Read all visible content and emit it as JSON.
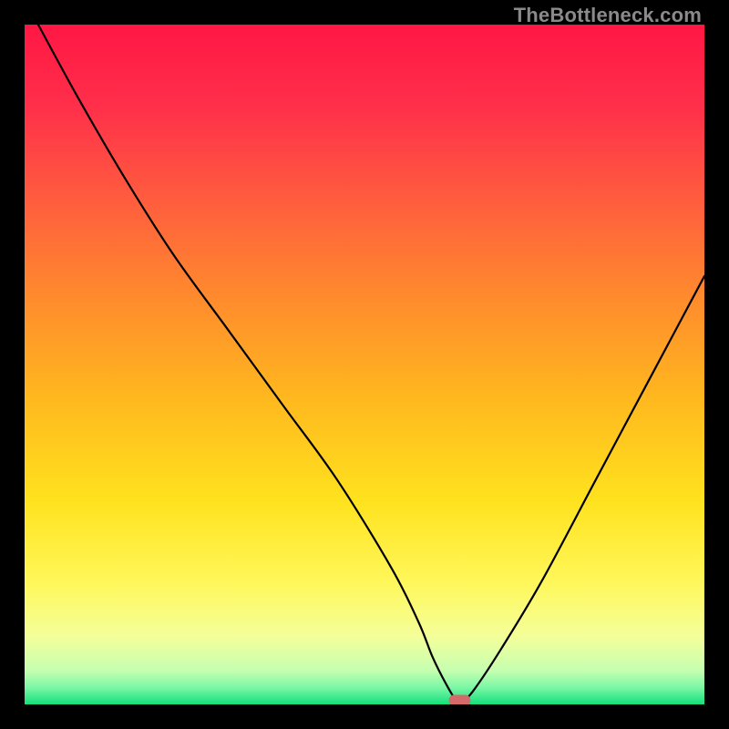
{
  "watermark": "TheBottleneck.com",
  "chart_data": {
    "type": "line",
    "title": "",
    "xlabel": "",
    "ylabel": "",
    "xlim": [
      0,
      100
    ],
    "ylim": [
      0,
      100
    ],
    "grid": false,
    "legend": false,
    "series": [
      {
        "name": "bottleneck-curve",
        "x": [
          2,
          8,
          15,
          22,
          30,
          38,
          46,
          54,
          58,
          60,
          62,
          63.5,
          64.5,
          66,
          70,
          76,
          84,
          92,
          100
        ],
        "y": [
          100,
          89,
          77,
          66,
          55,
          44,
          33,
          20,
          12,
          7,
          3,
          0.6,
          0.6,
          2,
          8,
          18,
          33,
          48,
          63
        ]
      }
    ],
    "marker": {
      "x_center": 64,
      "y": 0.6,
      "width": 3.2,
      "color": "#d46a6a"
    },
    "gradient_stops": [
      {
        "offset": 0.0,
        "color": "#ff1744"
      },
      {
        "offset": 0.12,
        "color": "#ff2f4a"
      },
      {
        "offset": 0.25,
        "color": "#ff5a3f"
      },
      {
        "offset": 0.4,
        "color": "#ff8a2d"
      },
      {
        "offset": 0.55,
        "color": "#ffb81e"
      },
      {
        "offset": 0.7,
        "color": "#ffe21e"
      },
      {
        "offset": 0.82,
        "color": "#fff75a"
      },
      {
        "offset": 0.9,
        "color": "#f4ff9a"
      },
      {
        "offset": 0.95,
        "color": "#c6ffb0"
      },
      {
        "offset": 0.975,
        "color": "#7cf7a6"
      },
      {
        "offset": 1.0,
        "color": "#13e07a"
      }
    ]
  }
}
